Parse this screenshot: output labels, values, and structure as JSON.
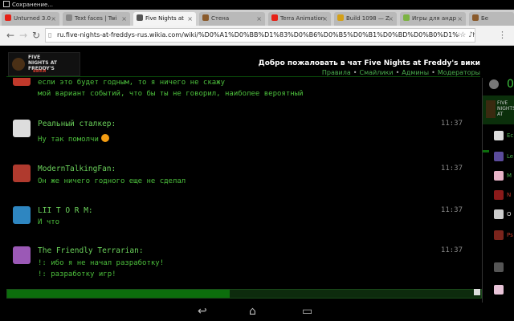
{
  "status_bar": {
    "text": "Сохранение..."
  },
  "tabs": [
    {
      "label": "Unturned 3.0 -",
      "color": "#e62117"
    },
    {
      "label": "Text faces | Twi",
      "color": "#888888"
    },
    {
      "label": "Five Nights at",
      "color": "#555555"
    },
    {
      "label": "Стена",
      "color": "#8a5a2b"
    },
    {
      "label": "Terra Animation",
      "color": "#e62117"
    },
    {
      "label": "Build 1098 — Z",
      "color": "#d4a017"
    },
    {
      "label": "Игры для андр",
      "color": "#7cb342"
    },
    {
      "label": "Бе",
      "color": "#8a5a2b"
    }
  ],
  "address_bar": {
    "url": "ru.five-nights-at-freddys-rus.wikia.com/wiki/%D0%A1%D0%BB%D1%83%D0%B6%D0%B5%D0%B1%D0%BD%D0%B0%D1%8F:Chat"
  },
  "logo": {
    "line1": "FIVE NIGHTS AT FREDDY'S",
    "line2": "вики"
  },
  "chat_header": {
    "welcome": "Добро пожаловать в чат Five Nights at Freddy's вики",
    "links": [
      "Правила",
      "Смайлики",
      "Админы",
      "Модераторы"
    ]
  },
  "messages": [
    {
      "user": "",
      "time": "",
      "avatar_color": "#c0392b",
      "lines": [
        "если это будет годным, то я ничего не скажу",
        "мой вариант событий, что бы ты не говорил, наиболее вероятный"
      ]
    },
    {
      "user": "Реальный сталкер:",
      "time": "11:37",
      "avatar_color": "#dddddd",
      "lines": [
        "Ну так помолчи"
      ],
      "emoji": true
    },
    {
      "user": "ModernTalkingFan:",
      "time": "11:37",
      "avatar_color": "#b03a2e",
      "lines": [
        "Он же ничего годного еще не сделал"
      ]
    },
    {
      "user": "LII T O R M:",
      "time": "11:37",
      "avatar_color": "#2e86c1",
      "lines": [
        "И что"
      ]
    },
    {
      "user": "The Friendly Terrarian:",
      "time": "11:37",
      "avatar_color": "#9b59b6",
      "lines": [
        "!: ибо я не начал разработку!",
        "!: разработку игр!"
      ]
    }
  ],
  "sidebar": {
    "online_count": "0",
    "room_name": "FIVE NIGHTS AT",
    "users": [
      {
        "name": "Ec",
        "color": "#4caf50"
      },
      {
        "name": "Le",
        "color": "#4caf50"
      },
      {
        "name": "M",
        "color": "#4caf50"
      },
      {
        "name": "N",
        "color": "#c0392b"
      },
      {
        "name": "O",
        "color": "#dddddd"
      },
      {
        "name": "Ps",
        "color": "#c0392b"
      },
      {
        "name": "",
        "color": "#4caf50"
      },
      {
        "name": "",
        "color": "#4caf50"
      }
    ]
  },
  "input": {
    "fill_fraction": 0.47
  }
}
